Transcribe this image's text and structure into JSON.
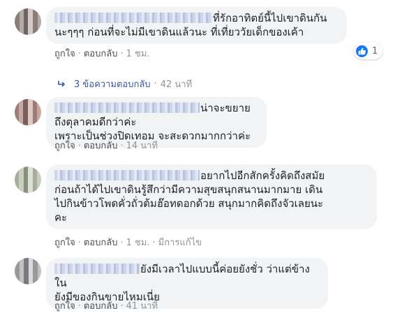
{
  "comments": [
    {
      "lines": [
        "ที่รักอาทิตย์นี้ไปเขาดินกัน",
        "นะๆๆๆ ก่อนที่จะไม่มีเขาดินแล้วนะ ที่เที่ยววัยเด็กของเค้า"
      ],
      "actions": {
        "like": "ถูกใจ",
        "reply": "ตอบกลับ",
        "time": "1 ชม."
      },
      "reaction": {
        "icon": "thumbs-up-icon",
        "count": "1",
        "color": "#1877f2"
      },
      "replies": {
        "label": "3 ข้อความตอบกลับ",
        "time": "42 นาที"
      }
    },
    {
      "lines": [
        "น่าจะขยายถึงตุลาคมดีกว่าค่ะ",
        "เพราะเป็นช่วงปิดเทอม จะสะดวกมากกว่าค่ะ"
      ],
      "actions": {
        "like": "ถูกใจ",
        "reply": "ตอบกลับ",
        "time": "14 นาที"
      }
    },
    {
      "lines": [
        "อยากไปอีกสักครั้งคิดถึงสมัย",
        "ก่อนถ้าได้ไปเขาดินรู้สึกว่ามีความสุขสนุกสนานมากมาย เดิน",
        "ไปกินข้าวโพดคั่วถั่วต้มฮ๊อทดอกด้วย สนุกมากคิดถึงจัวเลยนะ",
        "คะ"
      ],
      "actions": {
        "like": "ถูกใจ",
        "reply": "ตอบกลับ",
        "time": "1 ชม.",
        "edited": "มีการแก้ไข"
      }
    },
    {
      "lines": [
        "ยังมีเวลาไปแบบนี้ค่อยยังชั่ว ว่าแต่ข้างใน",
        "ยังมีของกินขายไหมเนี่ย"
      ],
      "actions": {
        "like": "ถูกใจ",
        "reply": "ตอบกลับ",
        "time": "41 นาที"
      }
    }
  ]
}
